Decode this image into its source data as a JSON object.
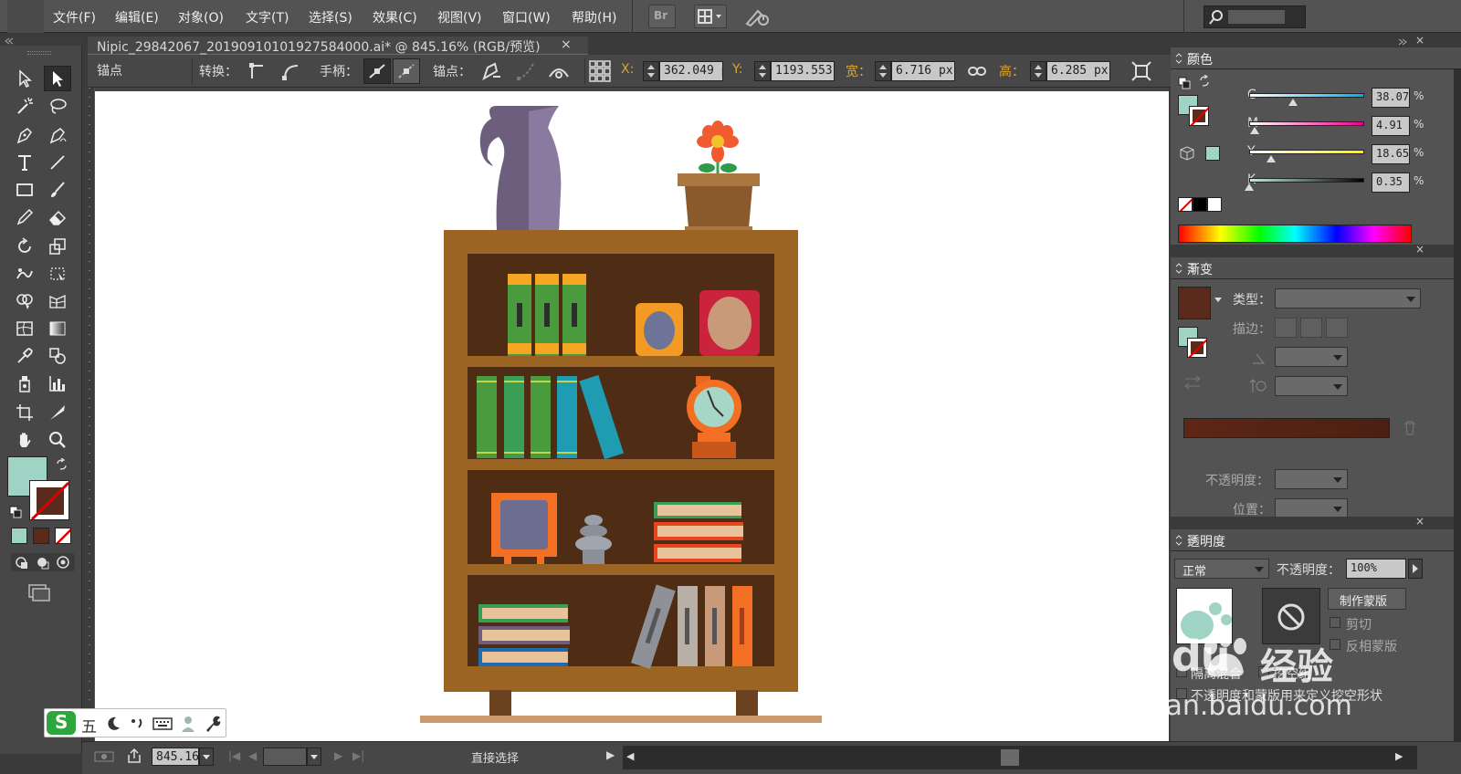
{
  "menu": [
    "文件(F)",
    "编辑(E)",
    "对象(O)",
    "文字(T)",
    "选择(S)",
    "效果(C)",
    "视图(V)",
    "窗口(W)",
    "帮助(H)"
  ],
  "menu_extra": {
    "bridge_label": "Br"
  },
  "document_tab": {
    "title": "Nipic_29842067_20190910101927584000.ai* @ 845.16% (RGB/预览)",
    "close": "×"
  },
  "control_bar": {
    "mode_label": "锚点",
    "convert_label": "转换：",
    "handle_label": "手柄：",
    "anchor_label": "锚点：",
    "x_label": "X:",
    "x_value": "362.049 p",
    "y_label": "Y:",
    "y_value": "1193.553",
    "w_label": "宽：",
    "w_value": "6.716 px",
    "h_label": "高：",
    "h_value": "6.285 px"
  },
  "colors": {
    "fill": "#9fd3c4",
    "swatch_dark": "#5a2a1c",
    "gradient_color": "#4e2314",
    "shelf_frame": "#9b6423",
    "shelf_inner": "#4e2d14"
  },
  "color_panel": {
    "title": "颜色",
    "channels": [
      {
        "label": "C",
        "value": "38.07",
        "unit": "%",
        "fraction": 0.38
      },
      {
        "label": "M",
        "value": "4.91",
        "unit": "%",
        "fraction": 0.05
      },
      {
        "label": "Y",
        "value": "18.65",
        "unit": "%",
        "fraction": 0.19
      },
      {
        "label": "K",
        "value": "0.35",
        "unit": "%",
        "fraction": 0.0
      }
    ]
  },
  "gradient_panel": {
    "title": "渐变",
    "type_label": "类型：",
    "stroke_label": "描边：",
    "opacity_label": "不透明度：",
    "position_label": "位置："
  },
  "transparency_panel": {
    "title": "透明度",
    "blend_mode": "正常",
    "opacity_label": "不透明度：",
    "opacity_value": "100%",
    "make_mask": "制作蒙版",
    "clip": "剪切",
    "invert_mask": "反相蒙版",
    "isolate_blend": "隔离混合",
    "knockout_group": "挖空组",
    "opacity_mask_shape": "不透明度和蒙版用来定义挖空形状"
  },
  "status_bar": {
    "zoom": "845.16",
    "tool_name": "直接选择"
  },
  "ime": {
    "label": "五"
  },
  "watermark": {
    "brand": "Baidu",
    "sub": "经验",
    "url": "jingyan.baidu.com"
  }
}
